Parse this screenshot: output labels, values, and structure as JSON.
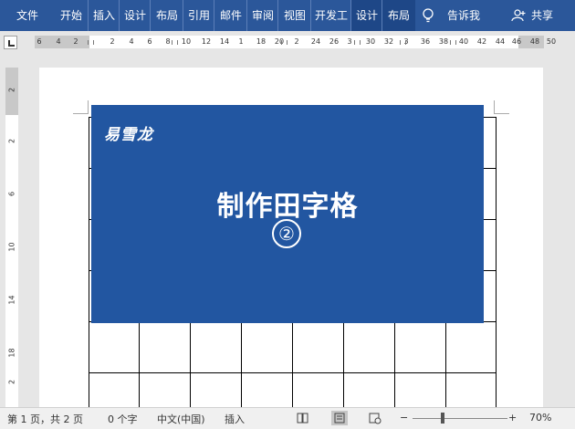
{
  "ribbon": {
    "tabs": [
      "文件",
      "开始",
      "插入",
      "设计",
      "布局",
      "引用",
      "邮件",
      "审阅",
      "视图",
      "开发工",
      "设计",
      "布局"
    ],
    "tell_me": "告诉我",
    "share": "共享"
  },
  "ruler": {
    "h_ticks": [
      "6",
      "4",
      "2",
      "2",
      "4",
      "6",
      "8",
      "10",
      "12",
      "14",
      "1",
      "18",
      "20",
      "2",
      "24",
      "26",
      "3",
      "30",
      "32",
      "3",
      "36",
      "38",
      "40",
      "42",
      "44",
      "46",
      "48",
      "50"
    ],
    "v_ticks": [
      "2",
      "2",
      "6",
      "10",
      "14",
      "18",
      "2"
    ]
  },
  "document": {
    "banner_logo": "易雪龙",
    "banner_title": "制作田字格",
    "banner_number": "②"
  },
  "status": {
    "page": "第 1 页，共 2 页",
    "words": "0 个字",
    "language": "中文(中国)",
    "mode": "插入",
    "zoom_minus": "−",
    "zoom_plus": "+",
    "zoom": "70%"
  },
  "colors": {
    "ribbon": "#2b579a",
    "banner": "#2256a1"
  }
}
